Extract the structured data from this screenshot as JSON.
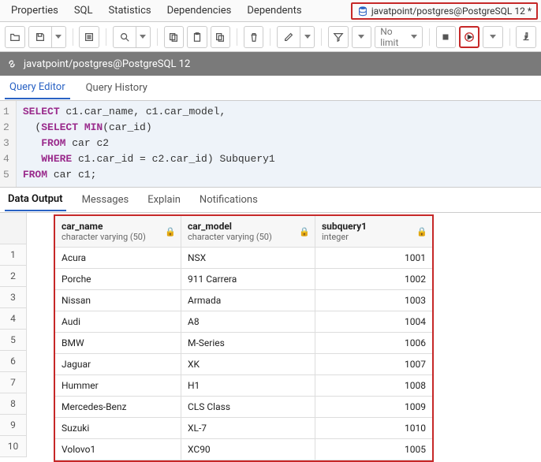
{
  "tabs": {
    "properties": "Properties",
    "sql": "SQL",
    "statistics": "Statistics",
    "dependencies": "Dependencies",
    "dependents": "Dependents",
    "file_tab": "javatpoint/postgres@PostgreSQL 12 *"
  },
  "toolbar": {
    "limit_label": "No limit"
  },
  "connection": {
    "label": "javatpoint/postgres@PostgreSQL 12"
  },
  "query_tabs": {
    "editor": "Query Editor",
    "history": "Query History"
  },
  "editor": {
    "lines": [
      "1",
      "2",
      "3",
      "4",
      "5"
    ]
  },
  "output_tabs": {
    "data": "Data Output",
    "messages": "Messages",
    "explain": "Explain",
    "notifications": "Notifications"
  },
  "grid": {
    "columns": [
      {
        "name": "car_name",
        "type": "character varying (50)"
      },
      {
        "name": "car_model",
        "type": "character varying (50)"
      },
      {
        "name": "subquery1",
        "type": "integer"
      }
    ],
    "rows": [
      {
        "n": "1",
        "car_name": "Acura",
        "car_model": "NSX",
        "subquery1": "1001"
      },
      {
        "n": "2",
        "car_name": "Porche",
        "car_model": "911 Carrera",
        "subquery1": "1002"
      },
      {
        "n": "3",
        "car_name": "Nissan",
        "car_model": "Armada",
        "subquery1": "1003"
      },
      {
        "n": "4",
        "car_name": "Audi",
        "car_model": "A8",
        "subquery1": "1004"
      },
      {
        "n": "5",
        "car_name": "BMW",
        "car_model": "M-Series",
        "subquery1": "1006"
      },
      {
        "n": "6",
        "car_name": "Jaguar",
        "car_model": "XK",
        "subquery1": "1007"
      },
      {
        "n": "7",
        "car_name": "Hummer",
        "car_model": "H1",
        "subquery1": "1008"
      },
      {
        "n": "8",
        "car_name": "Mercedes-Benz",
        "car_model": "CLS Class",
        "subquery1": "1009"
      },
      {
        "n": "9",
        "car_name": "Suzuki",
        "car_model": "XL-7",
        "subquery1": "1010"
      },
      {
        "n": "10",
        "car_name": "Volovo1",
        "car_model": "XC90",
        "subquery1": "1005"
      }
    ]
  },
  "sql": {
    "line1_a": "SELECT",
    "line1_b": " c1.car_name, c1.car_model,",
    "line2_a": "  (",
    "line2_b": "SELECT MIN",
    "line2_c": "(car_id)",
    "line3_a": "   ",
    "line3_b": "FROM",
    "line3_c": " car c2",
    "line4_a": "   ",
    "line4_b": "WHERE",
    "line4_c": " c1.car_id = c2.car_id) Subquery1",
    "line5_a": "FROM",
    "line5_b": " car c1;"
  }
}
